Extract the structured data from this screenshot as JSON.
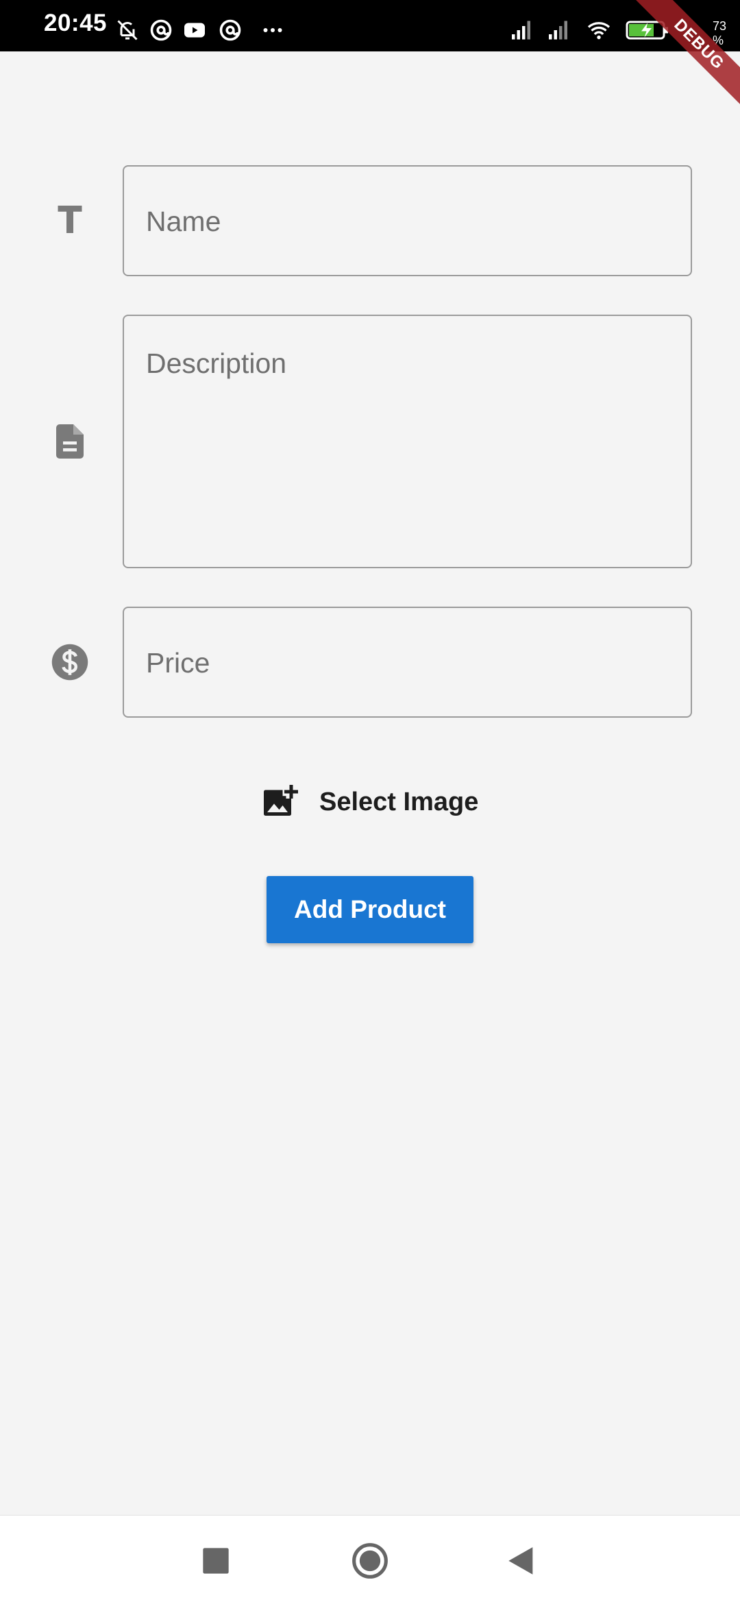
{
  "status_bar": {
    "time": "20:45",
    "battery_text": "73 %",
    "icons": [
      "notifications-off-icon",
      "at-icon",
      "youtube-icon",
      "at-icon",
      "more-icon",
      "signal-icon",
      "signal-icon",
      "wifi-icon",
      "battery-charging-icon"
    ]
  },
  "debug_banner": {
    "label": "DEBUG"
  },
  "form": {
    "name": {
      "placeholder": "Name",
      "value": "",
      "icon": "text-icon"
    },
    "description": {
      "placeholder": "Description",
      "value": "",
      "icon": "document-icon"
    },
    "price": {
      "placeholder": "Price",
      "value": "",
      "icon": "dollar-icon"
    },
    "select_image": {
      "label": "Select Image",
      "icon": "add-photo-icon"
    },
    "add_button": {
      "label": "Add Product"
    }
  },
  "nav_bar": {
    "buttons": [
      "recents-button",
      "home-button",
      "back-button"
    ]
  },
  "colors": {
    "background": "#f4f4f4",
    "primary": "#1976d2",
    "icon_gray": "#7a7a7a",
    "status_bar": "#000000",
    "debug_banner": "#a01e23"
  }
}
